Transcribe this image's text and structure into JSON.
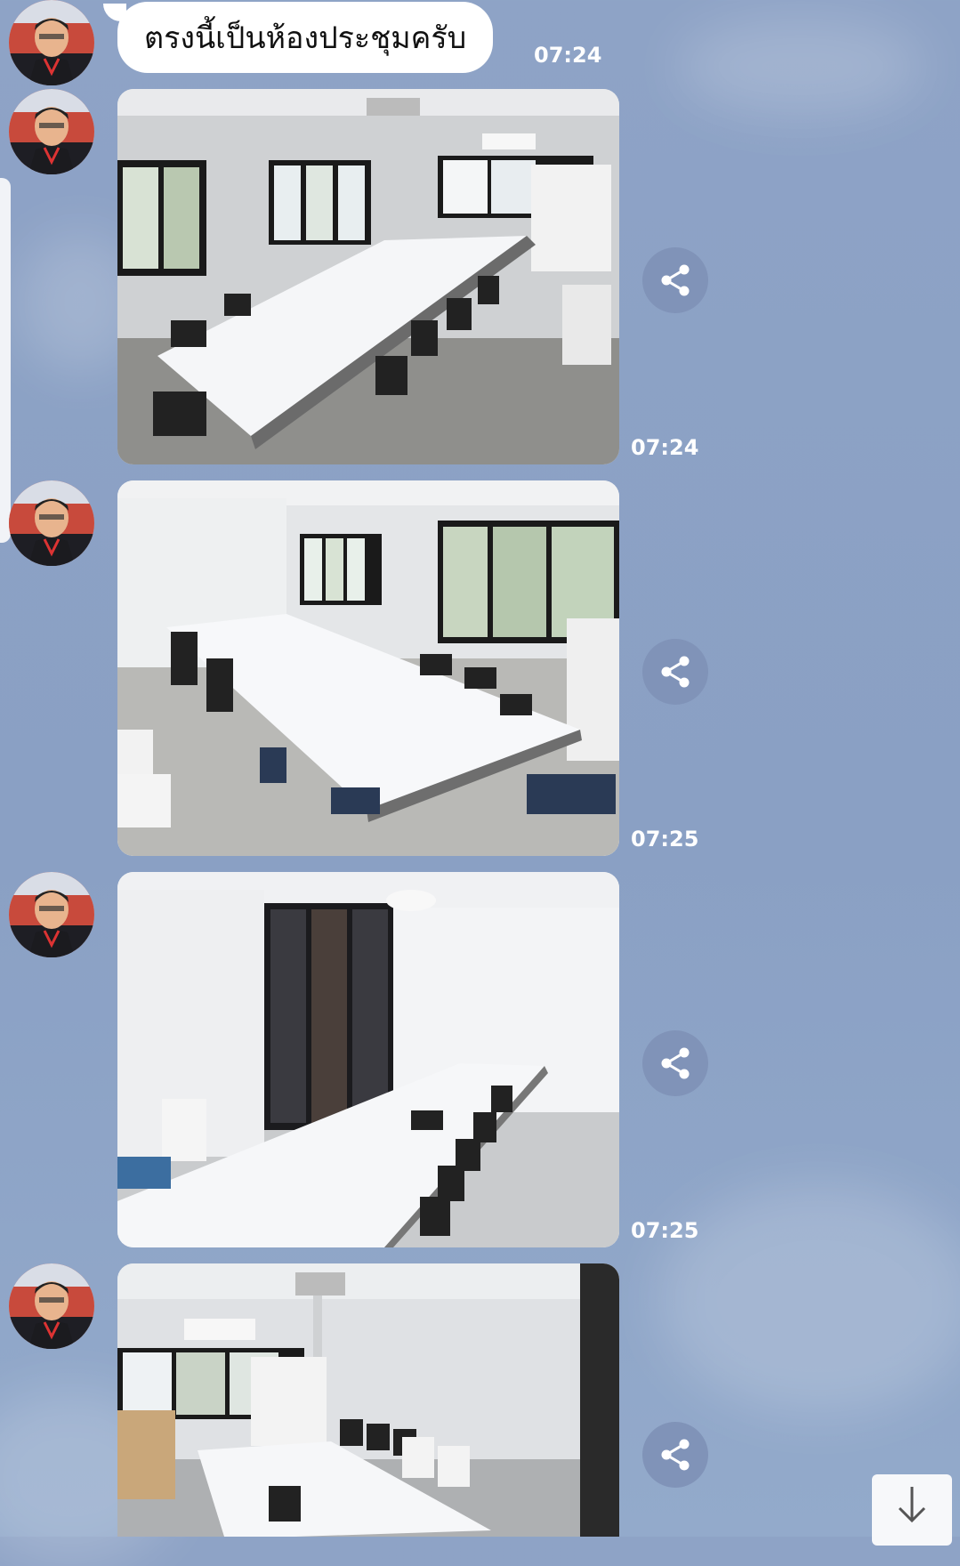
{
  "chat": {
    "messages": [
      {
        "type": "text",
        "text": "ตรงนี้เป็นห้องประชุมครับ",
        "time": "07:24"
      },
      {
        "type": "image",
        "alt": "meeting room photo 1",
        "time": "07:24"
      },
      {
        "type": "image",
        "alt": "meeting room photo 2",
        "time": "07:25"
      },
      {
        "type": "image",
        "alt": "meeting room photo 3",
        "time": "07:25"
      },
      {
        "type": "image",
        "alt": "meeting room photo 4",
        "time": ""
      }
    ]
  },
  "icons": {
    "share": "share-icon",
    "scroll_down": "arrow-down-icon",
    "avatar": "avatar"
  },
  "colors": {
    "background": "#8ea3c6",
    "bubble": "#ffffff",
    "share_button": "#8093b8",
    "time_text": "#ffffff"
  }
}
